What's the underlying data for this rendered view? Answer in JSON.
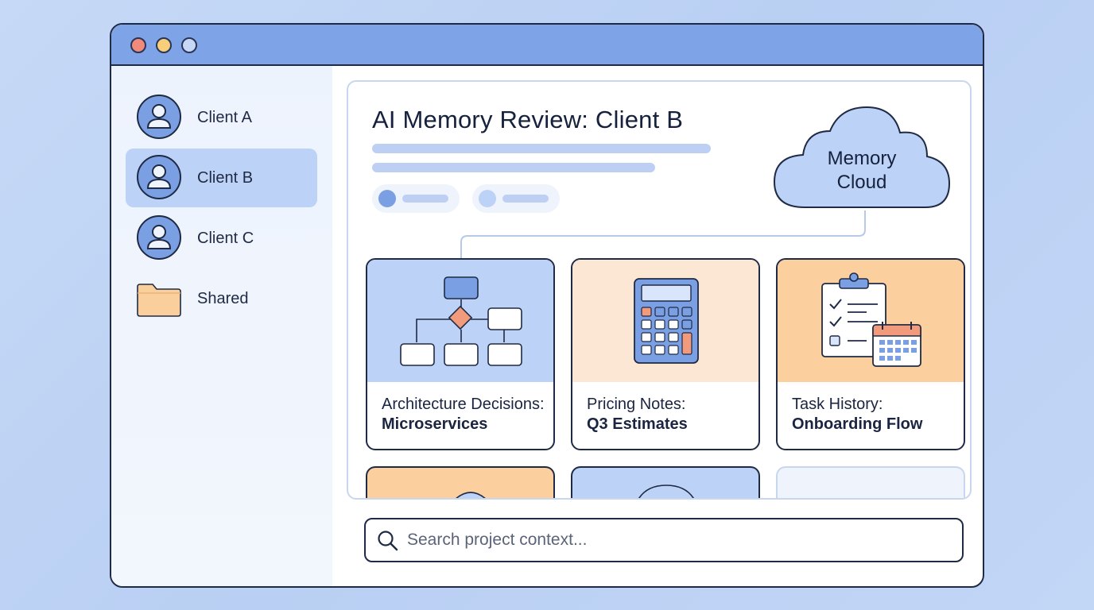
{
  "window": {
    "controls": [
      "close",
      "minimize",
      "maximize"
    ]
  },
  "sidebar": {
    "items": [
      {
        "label": "Client A",
        "icon": "user-avatar-icon",
        "active": false
      },
      {
        "label": "Client B",
        "icon": "user-avatar-icon",
        "active": true
      },
      {
        "label": "Client C",
        "icon": "user-avatar-icon",
        "active": false
      },
      {
        "label": "Shared",
        "icon": "folder-icon",
        "active": false
      }
    ]
  },
  "main": {
    "title": "AI Memory Review: Client B",
    "cloud": {
      "line1": "Memory",
      "line2": "Cloud",
      "icon": "cloud-icon"
    },
    "cards": [
      {
        "title": "Architecture Decisions:",
        "subtitle": "Microservices",
        "icon": "flowchart-icon",
        "color": "#bcd2f6"
      },
      {
        "title": "Pricing Notes:",
        "subtitle": "Q3 Estimates",
        "icon": "calculator-icon",
        "color": "#fce7d4"
      },
      {
        "title": "Task History:",
        "subtitle": "Onboarding Flow",
        "icon": "clipboard-calendar-icon",
        "color": "#fccf9f"
      }
    ]
  },
  "search": {
    "placeholder": "Search project context...",
    "value": ""
  },
  "colors": {
    "accent": "#7ea3e6",
    "active_item": "#bcd2f6",
    "outline": "#1f2a44",
    "close": "#f08a7a",
    "minimize": "#f7cf7a",
    "maximize": "#c7d8f7"
  }
}
